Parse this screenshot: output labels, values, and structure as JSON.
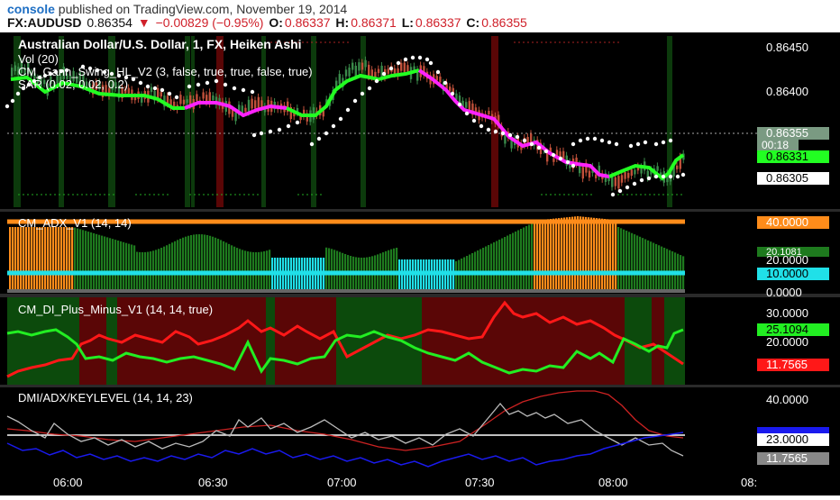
{
  "header": {
    "user": "console",
    "published": " published on TradingView.com, November 19, 2014",
    "symbol": "FX:AUDUSD",
    "last": "0.86354",
    "change": "−0.00829 (−0.95%)",
    "open_label": "O:",
    "open": "0.86337",
    "high_label": "H:",
    "high": "0.86371",
    "low_label": "L:",
    "low": "0.86337",
    "close_label": "C:",
    "close": "0.86355",
    "change_color": "#d0202a"
  },
  "panes": {
    "main": {
      "title": "Australian Dollar/U.S. Dollar, 1, FX, Heiken Ashi",
      "indicators": [
        "Vol (20)",
        "CM_Gann_Swing_HL_V2 (3, false, true, true, false, true)",
        "SAR (0.02, 0.02, 0.2)"
      ],
      "price_ticks": [
        "0.86450",
        "0.86400",
        "0.86305"
      ],
      "last_price": "0.86355",
      "countdown": "00:18",
      "gann_price": "0.86331"
    },
    "adx": {
      "title": "CM_ADX_V1 (14, 14)",
      "labels": [
        "40.0000",
        "20.0000",
        "10.0000",
        "0.0000",
        "20.1081"
      ]
    },
    "di": {
      "title": "CM_DI_Plus_Minus_V1 (14, 14, true)",
      "labels": [
        "30.0000",
        "25.1094",
        "20.0000",
        "11.7565"
      ]
    },
    "dmi": {
      "title": "DMI/ADX/KEYLEVEL (14, 14, 23)",
      "labels": [
        "40.0000",
        "23.0000",
        "11.7565"
      ]
    }
  },
  "time_axis": [
    "06:00",
    "06:30",
    "07:00",
    "07:30",
    "08:00",
    "08:"
  ],
  "colors": {
    "up_candle": "#3a8a4a",
    "down_candle": "#c0503a",
    "gann_up": "#22ff22",
    "gann_down": "#ff22ff",
    "adx_orange": "#ff8c1a",
    "adx_green": "#1e7a1e",
    "adx_cyan": "#20e0e8",
    "di_plus": "#22ee22",
    "di_minus": "#ff1818",
    "bg_green": "#0c4a0c",
    "bg_red": "#5a0606",
    "dmi_blue": "#1a1aee"
  }
}
